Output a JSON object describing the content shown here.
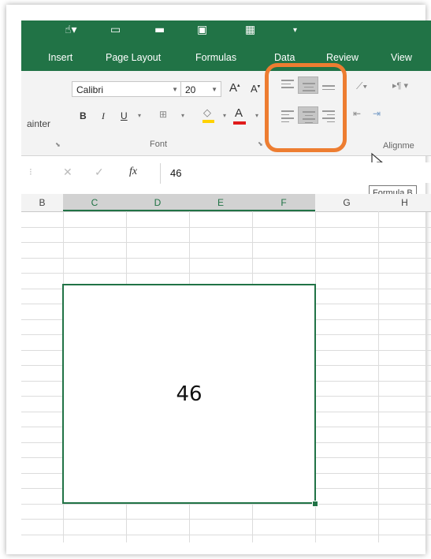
{
  "ribbon_tabs": [
    "Insert",
    "Page Layout",
    "Formulas",
    "Data",
    "Review",
    "View"
  ],
  "clipboard": {
    "format_painter_label": "ainter"
  },
  "font": {
    "name": "Calibri",
    "size": "20",
    "grow_label": "A",
    "shrink_label": "A",
    "bold_label": "B",
    "italic_label": "I",
    "underline_label": "U",
    "group_label": "Font"
  },
  "alignment": {
    "group_label": "Alignme",
    "highlight_color": "#ed7d31"
  },
  "formula_bar": {
    "value": "46",
    "fx_label": "fx",
    "tooltip": "Formula B"
  },
  "columns": [
    "B",
    "C",
    "D",
    "E",
    "F",
    "G",
    "H"
  ],
  "selected_columns": [
    "C",
    "D",
    "E",
    "F"
  ],
  "cell": {
    "value": "46"
  },
  "colors": {
    "excel_green": "#217346",
    "highlight_orange": "#ed7d31"
  }
}
